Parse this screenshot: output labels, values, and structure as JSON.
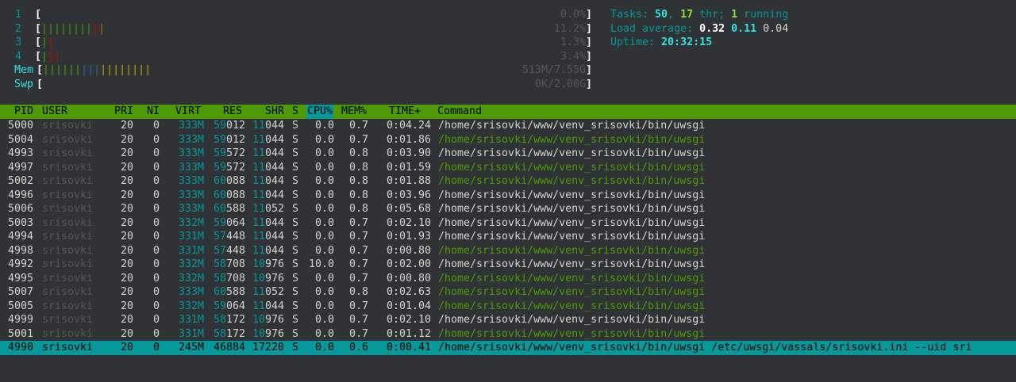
{
  "cpus": [
    {
      "label": "1",
      "bars": [],
      "value": "0.0%"
    },
    {
      "label": "2",
      "bars": [
        {
          "c": "green",
          "n": 8
        },
        {
          "c": "red",
          "n": 1
        },
        {
          "c": "orange",
          "n": 1
        }
      ],
      "value": "11.2%"
    },
    {
      "label": "3",
      "bars": [
        {
          "c": "green",
          "n": 1
        },
        {
          "c": "red",
          "n": 1
        }
      ],
      "value": "1.3%"
    },
    {
      "label": "4",
      "bars": [
        {
          "c": "green",
          "n": 1
        },
        {
          "c": "red",
          "n": 2
        }
      ],
      "value": "3.4%"
    }
  ],
  "mem": {
    "label": "Mem",
    "bars": [
      {
        "c": "green",
        "n": 6
      },
      {
        "c": "blue",
        "n": 3
      },
      {
        "c": "yellow",
        "n": 8
      }
    ],
    "value": "513M/7.55G"
  },
  "swp": {
    "label": "Swp",
    "bars": [],
    "value": "0K/2.00G"
  },
  "summary": {
    "tasks_label": "Tasks: ",
    "tasks": "50",
    "sep1": ", ",
    "threads": "17",
    "thr_label": " thr; ",
    "running": "1",
    "running_label": " running",
    "load_label": "Load average: ",
    "load1": "0.32",
    "load5": "0.11",
    "load15": "0.04",
    "uptime_label": "Uptime: ",
    "uptime": "20:32:15"
  },
  "columns": [
    "PID",
    "USER",
    "PRI",
    "NI",
    "VIRT",
    "RES",
    "SHR",
    "S",
    "CPU%",
    "MEM%",
    "TIME+",
    "Command"
  ],
  "processes": [
    {
      "pid": "5000",
      "user": "srisovki",
      "pri": "20",
      "ni": "0",
      "virt": "333M",
      "res": "59012",
      "shr": "11044",
      "s": "S",
      "cpu": "0.0",
      "mem": "0.7",
      "time": "0:04.24",
      "cmd": "/home/srisovki/www/venv_srisovki/bin/uwsgi",
      "thread": false
    },
    {
      "pid": "5004",
      "user": "srisovki",
      "pri": "20",
      "ni": "0",
      "virt": "333M",
      "res": "59012",
      "shr": "11044",
      "s": "S",
      "cpu": "0.0",
      "mem": "0.7",
      "time": "0:01.86",
      "cmd": "/home/srisovki/www/venv_srisovki/bin/uwsgi",
      "thread": true
    },
    {
      "pid": "4993",
      "user": "srisovki",
      "pri": "20",
      "ni": "0",
      "virt": "333M",
      "res": "59572",
      "shr": "11044",
      "s": "S",
      "cpu": "0.0",
      "mem": "0.8",
      "time": "0:03.90",
      "cmd": "/home/srisovki/www/venv_srisovki/bin/uwsgi",
      "thread": false
    },
    {
      "pid": "4997",
      "user": "srisovki",
      "pri": "20",
      "ni": "0",
      "virt": "333M",
      "res": "59572",
      "shr": "11044",
      "s": "S",
      "cpu": "0.0",
      "mem": "0.8",
      "time": "0:01.59",
      "cmd": "/home/srisovki/www/venv_srisovki/bin/uwsgi",
      "thread": true
    },
    {
      "pid": "5002",
      "user": "srisovki",
      "pri": "20",
      "ni": "0",
      "virt": "333M",
      "res": "60088",
      "shr": "11044",
      "s": "S",
      "cpu": "0.0",
      "mem": "0.8",
      "time": "0:01.88",
      "cmd": "/home/srisovki/www/venv_srisovki/bin/uwsgi",
      "thread": true
    },
    {
      "pid": "4996",
      "user": "srisovki",
      "pri": "20",
      "ni": "0",
      "virt": "333M",
      "res": "60088",
      "shr": "11044",
      "s": "S",
      "cpu": "0.0",
      "mem": "0.8",
      "time": "0:03.96",
      "cmd": "/home/srisovki/www/venv_srisovki/bin/uwsgi",
      "thread": false
    },
    {
      "pid": "5006",
      "user": "srisovki",
      "pri": "20",
      "ni": "0",
      "virt": "333M",
      "res": "60588",
      "shr": "11052",
      "s": "S",
      "cpu": "0.0",
      "mem": "0.8",
      "time": "0:05.68",
      "cmd": "/home/srisovki/www/venv_srisovki/bin/uwsgi",
      "thread": false
    },
    {
      "pid": "5003",
      "user": "srisovki",
      "pri": "20",
      "ni": "0",
      "virt": "332M",
      "res": "59064",
      "shr": "11044",
      "s": "S",
      "cpu": "0.0",
      "mem": "0.7",
      "time": "0:02.10",
      "cmd": "/home/srisovki/www/venv_srisovki/bin/uwsgi",
      "thread": false
    },
    {
      "pid": "4994",
      "user": "srisovki",
      "pri": "20",
      "ni": "0",
      "virt": "331M",
      "res": "57448",
      "shr": "11044",
      "s": "S",
      "cpu": "0.0",
      "mem": "0.7",
      "time": "0:01.93",
      "cmd": "/home/srisovki/www/venv_srisovki/bin/uwsgi",
      "thread": false
    },
    {
      "pid": "4998",
      "user": "srisovki",
      "pri": "20",
      "ni": "0",
      "virt": "331M",
      "res": "57448",
      "shr": "11044",
      "s": "S",
      "cpu": "0.0",
      "mem": "0.7",
      "time": "0:00.80",
      "cmd": "/home/srisovki/www/venv_srisovki/bin/uwsgi",
      "thread": true
    },
    {
      "pid": "4992",
      "user": "srisovki",
      "pri": "20",
      "ni": "0",
      "virt": "332M",
      "res": "58708",
      "shr": "10976",
      "s": "S",
      "cpu": "10.0",
      "mem": "0.7",
      "time": "0:02.00",
      "cmd": "/home/srisovki/www/venv_srisovki/bin/uwsgi",
      "thread": false
    },
    {
      "pid": "4995",
      "user": "srisovki",
      "pri": "20",
      "ni": "0",
      "virt": "332M",
      "res": "58708",
      "shr": "10976",
      "s": "S",
      "cpu": "0.0",
      "mem": "0.7",
      "time": "0:00.80",
      "cmd": "/home/srisovki/www/venv_srisovki/bin/uwsgi",
      "thread": true
    },
    {
      "pid": "5007",
      "user": "srisovki",
      "pri": "20",
      "ni": "0",
      "virt": "333M",
      "res": "60588",
      "shr": "11052",
      "s": "S",
      "cpu": "0.0",
      "mem": "0.8",
      "time": "0:02.63",
      "cmd": "/home/srisovki/www/venv_srisovki/bin/uwsgi",
      "thread": true
    },
    {
      "pid": "5005",
      "user": "srisovki",
      "pri": "20",
      "ni": "0",
      "virt": "332M",
      "res": "59064",
      "shr": "11044",
      "s": "S",
      "cpu": "0.0",
      "mem": "0.7",
      "time": "0:01.04",
      "cmd": "/home/srisovki/www/venv_srisovki/bin/uwsgi",
      "thread": true
    },
    {
      "pid": "4999",
      "user": "srisovki",
      "pri": "20",
      "ni": "0",
      "virt": "331M",
      "res": "58172",
      "shr": "10976",
      "s": "S",
      "cpu": "0.0",
      "mem": "0.7",
      "time": "0:02.10",
      "cmd": "/home/srisovki/www/venv_srisovki/bin/uwsgi",
      "thread": false
    },
    {
      "pid": "5001",
      "user": "srisovki",
      "pri": "20",
      "ni": "0",
      "virt": "331M",
      "res": "58172",
      "shr": "10976",
      "s": "S",
      "cpu": "0.0",
      "mem": "0.7",
      "time": "0:01.12",
      "cmd": "/home/srisovki/www/venv_srisovki/bin/uwsgi",
      "thread": true
    },
    {
      "pid": "4990",
      "user": "srisovki",
      "pri": "20",
      "ni": "0",
      "virt": "245M",
      "res": "46884",
      "shr": "17220",
      "s": "S",
      "cpu": "0.0",
      "mem": "0.6",
      "time": "0:00.41",
      "cmd": "/home/srisovki/www/venv_srisovki/bin/uwsgi /etc/uwsgi/vassals/srisovki.ini --uid sri",
      "thread": false,
      "selected": true
    }
  ],
  "colors": {
    "background": "#2f3335",
    "header_bg": "#4e9a06",
    "selected_bg": "#06989a",
    "cyan": "#34e2e2",
    "green": "#4e9a06"
  }
}
